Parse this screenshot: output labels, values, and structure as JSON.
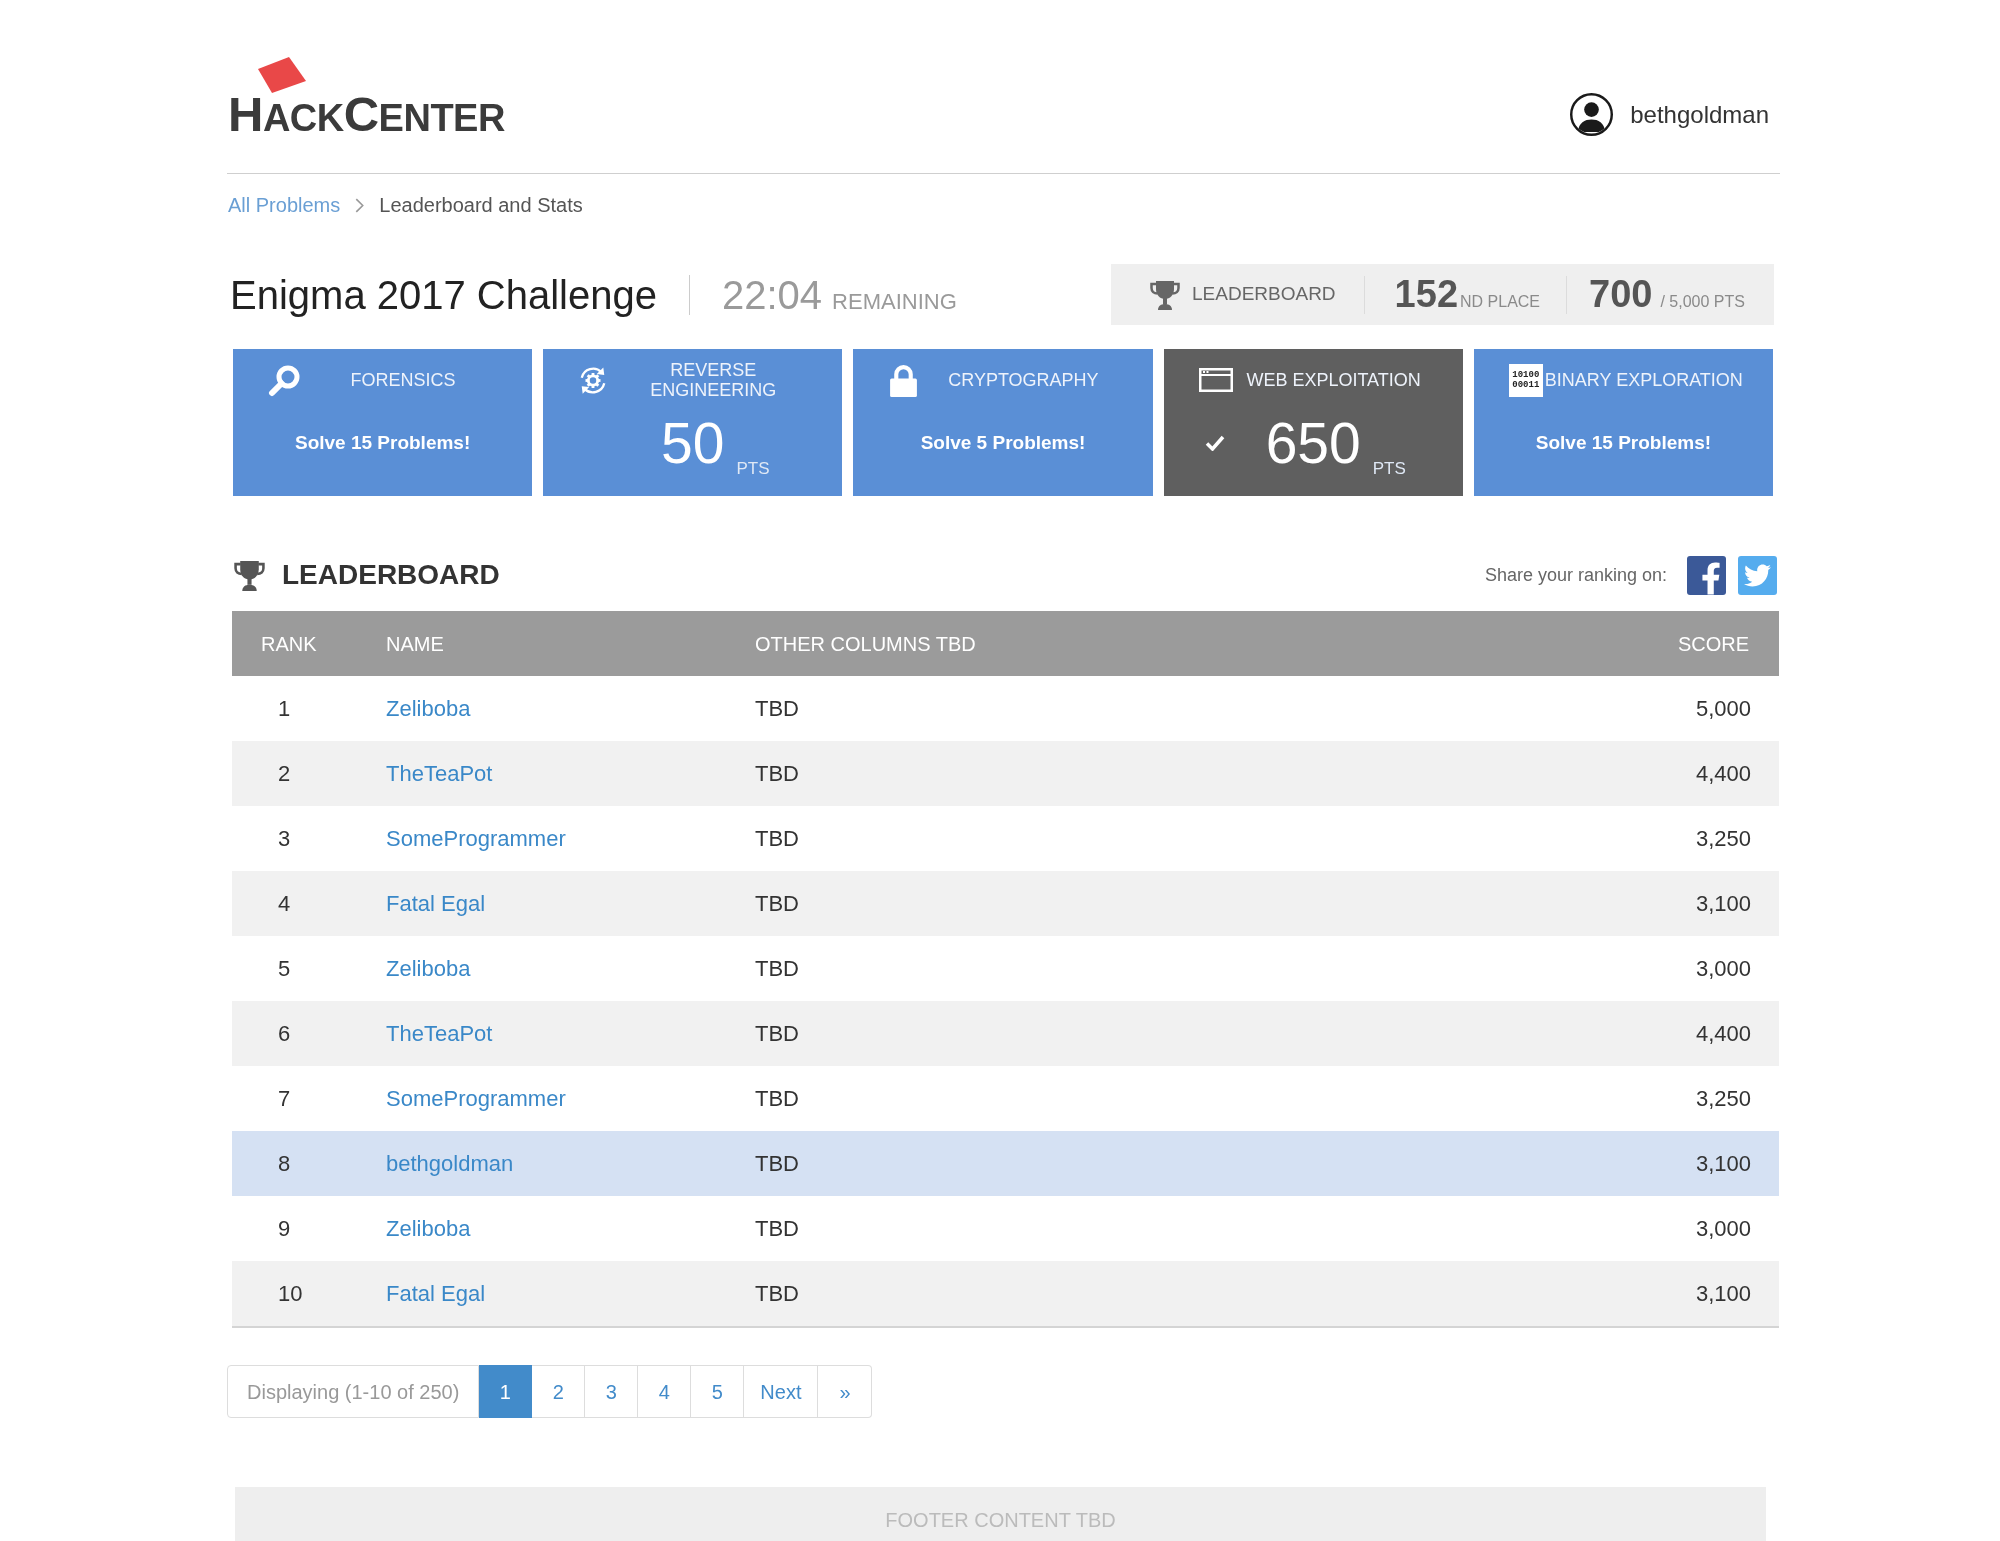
{
  "header": {
    "logo": [
      "HACK",
      "CENTER"
    ],
    "username": "bethgoldman"
  },
  "breadcrumb": [
    {
      "label": "All Problems",
      "kind": "link"
    },
    {
      "label": "Leaderboard and Stats",
      "kind": "current"
    }
  ],
  "challenge": {
    "title": "Enigma 2017 Challenge",
    "time": "22:04",
    "time_label": "REMAINING"
  },
  "stats": {
    "label": "LEADERBOARD",
    "place": "152",
    "place_suffix": "ND PLACE",
    "points": "700",
    "points_total": "/ 5,000 PTS"
  },
  "categories": [
    {
      "title": "FORENSICS",
      "kind": "goal",
      "completed": false,
      "goal": "Solve 15 Problems!"
    },
    {
      "title": "REVERSE ENGINEERING",
      "kind": "points",
      "completed": false,
      "points": "50",
      "unit": "PTS"
    },
    {
      "title": "CRYPTOGRAPHY",
      "kind": "goal",
      "completed": false,
      "goal": "Solve 5 Problems!"
    },
    {
      "title": "WEB EXPLOITATION",
      "kind": "points",
      "completed": true,
      "points": "650",
      "unit": "PTS"
    },
    {
      "title": "BINARY EXPLORATION",
      "kind": "goal",
      "completed": false,
      "goal": "Solve 15 Problems!",
      "icon_text": [
        "10100",
        "00011"
      ]
    }
  ],
  "leaderboard": {
    "title": "LEADERBOARD",
    "share_label": "Share your ranking on:",
    "columns": [
      "RANK",
      "NAME",
      "OTHER COLUMNS TBD",
      "SCORE"
    ],
    "rows": [
      {
        "rank": "1",
        "name": "Zeliboba",
        "other": "TBD",
        "score": "5,000",
        "selected": false
      },
      {
        "rank": "2",
        "name": "TheTeaPot",
        "other": "TBD",
        "score": "4,400",
        "selected": false
      },
      {
        "rank": "3",
        "name": "SomeProgrammer",
        "other": "TBD",
        "score": "3,250",
        "selected": false
      },
      {
        "rank": "4",
        "name": "Fatal Egal",
        "other": "TBD",
        "score": "3,100",
        "selected": false
      },
      {
        "rank": "5",
        "name": "Zeliboba",
        "other": "TBD",
        "score": "3,000",
        "selected": false
      },
      {
        "rank": "6",
        "name": "TheTeaPot",
        "other": "TBD",
        "score": "4,400",
        "selected": false
      },
      {
        "rank": "7",
        "name": "SomeProgrammer",
        "other": "TBD",
        "score": "3,250",
        "selected": false
      },
      {
        "rank": "8",
        "name": "bethgoldman",
        "other": "TBD",
        "score": "3,100",
        "selected": true
      },
      {
        "rank": "9",
        "name": "Zeliboba",
        "other": "TBD",
        "score": "3,000",
        "selected": false
      },
      {
        "rank": "10",
        "name": "Fatal Egal",
        "other": "TBD",
        "score": "3,100",
        "selected": false
      }
    ]
  },
  "pagination": {
    "info": "Displaying (1-10 of 250)",
    "pages": [
      {
        "label": "1",
        "selected": true
      },
      {
        "label": "2",
        "selected": false
      },
      {
        "label": "3",
        "selected": false
      },
      {
        "label": "4",
        "selected": false
      },
      {
        "label": "5",
        "selected": false
      }
    ],
    "next": "Next",
    "last": "»"
  },
  "footer": {
    "text": "FOOTER CONTENT TBD"
  }
}
